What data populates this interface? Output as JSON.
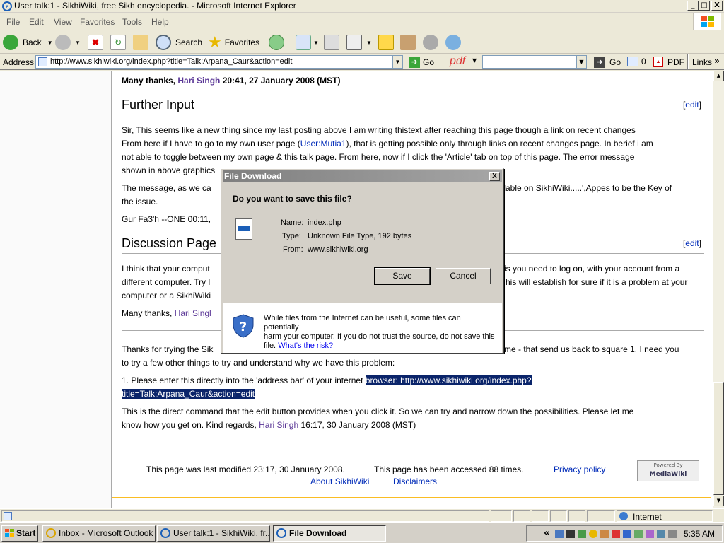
{
  "window": {
    "title": "User talk:1 - SikhiWiki, free Sikh encyclopedia. - Microsoft Internet Explorer",
    "min": "_",
    "max": "□",
    "close": "X"
  },
  "menu": [
    "File",
    "Edit",
    "View",
    "Favorites",
    "Tools",
    "Help"
  ],
  "toolbar": {
    "back": "Back",
    "search": "Search",
    "favorites": "Favorites"
  },
  "address": {
    "label": "Address",
    "url": "http://www.sikhiwiki.org/index.php?title=Talk:Arpana_Caur&action=edit",
    "go": "Go",
    "pdf_logo": "pdf",
    "go2": "Go",
    "count": "0",
    "pdf": "PDF",
    "links": "Links"
  },
  "article": {
    "top_line_a": "Many thanks, ",
    "top_line_user": "Hari Singh",
    "top_line_b": " 20:41, 27 January 2008 (MST)",
    "h_further": "Further Input",
    "edit": "edit",
    "p1_l1": "Sir, This seems like a new thing since my last posting above I am writing thistext after reaching this page though a link on recent changes",
    "p1_l2a": "From here if I have to go to my own user page (",
    "p1_l2link": "User:Mutia1",
    "p1_l2b": "), that is getting possible only through links on recent changes page. In berief i am",
    "p1_l3": "not able to toggle between my own page & this talk page. From here, now if I click the 'Article' tab on top of this page. The error message",
    "p1_l4": "shown in above graphics",
    "p2_l1a": "The message, as we ca",
    "p2_l1b": "ailable on SikhiWiki.....',Appes to be the Key of",
    "p2_l2": "the issue.",
    "sig1": "Gur Fa3'h --ONE 00:11,",
    "h_discussion": "Discussion Page",
    "p3_l1a": "I think that your comput",
    "p3_l1b": "is you need to log on, with your account from a",
    "p3_l2a": "different computer. Try l",
    "p3_l2b": "his will establish for sure if it is a problem at your",
    "p3_l3": "computer or a SikhiWiki",
    "p4a": "Many thanks, ",
    "p4user": "Hari Singl",
    "p5_l1a": "Thanks for trying the Sik",
    "p5_l1b": "me - that send us back to square 1. I need you",
    "p5_l2": "to try a few other things to try and understand why we have this problem:",
    "p6a": "1. Please enter this directly into the 'address bar' of your internet ",
    "p6hl1": "browser: http://www.sikhiwiki.org/index.php?",
    "p6hl2": "title=Talk:Arpana_Caur&action=edit",
    "p7_l1": "This is the direct command that the edit button provides when you click it. So we can try and narrow down the possibilities. Please let me",
    "p7_l2a": "know how you get on. Kind regards, ",
    "p7_user": "Hari Singh",
    "p7_l2b": " 16:17, 30 January 2008 (MST)"
  },
  "footer": {
    "modified": "This page was last modified 23:17, 30 January 2008.",
    "accessed": "This page has been accessed 88 times.",
    "privacy": "Privacy policy",
    "about": "About SikhiWiki",
    "disclaimers": "Disclaimers",
    "badge_top": "Powered By",
    "badge_main": "MediaWiki"
  },
  "dialog": {
    "title": "File Download",
    "close": "X",
    "question": "Do you want to save this file?",
    "name_label": "Name:",
    "name_value": "index.php",
    "type_label": "Type:",
    "type_value": "Unknown File Type, 192 bytes",
    "from_label": "From:",
    "from_value": "www.sikhiwiki.org",
    "save": "Save",
    "cancel": "Cancel",
    "warn_l1": "While files from the Internet can be useful, some files can potentially",
    "warn_l2": "harm your computer. If you do not trust the source, do not save this",
    "warn_l3a": "file. ",
    "warn_link": "What's the risk?"
  },
  "statusbar": {
    "zone": "Internet"
  },
  "taskbar": {
    "start": "Start",
    "tasks": [
      "Inbox - Microsoft Outlook",
      "User talk:1 - SikhiWiki, fr...",
      "File Download"
    ],
    "clock": "5:35 AM",
    "chevron": "«"
  },
  "colors": {
    "link": "#002bb8",
    "visited_link": "#5a3696",
    "highlight": "#0a246a",
    "footer_border": "#fabd23"
  }
}
